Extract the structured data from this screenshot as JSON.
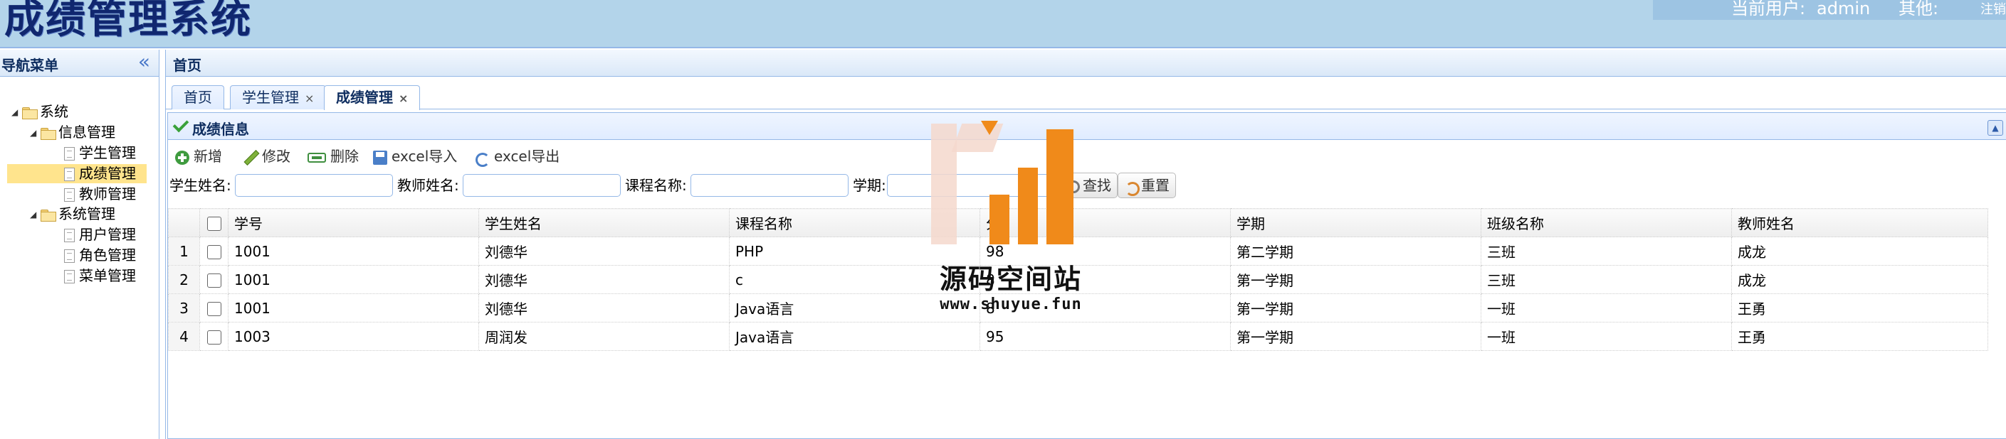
{
  "app_title": "成绩管理系统",
  "userbar": {
    "current_user_label": "当前用户:",
    "current_user": "admin",
    "other_label": "其他:",
    "logout": "注销"
  },
  "nav": {
    "title": "导航菜单",
    "collapse_icon": "double-chevron-left-icon",
    "tree": [
      {
        "label": "系统",
        "type": "folder",
        "level": 0
      },
      {
        "label": "信息管理",
        "type": "folder",
        "level": 1
      },
      {
        "label": "学生管理",
        "type": "file",
        "level": 2
      },
      {
        "label": "成绩管理",
        "type": "file",
        "level": 2,
        "selected": true
      },
      {
        "label": "教师管理",
        "type": "file",
        "level": 2
      },
      {
        "label": "系统管理",
        "type": "folder",
        "level": 1
      },
      {
        "label": "用户管理",
        "type": "file",
        "level": 2
      },
      {
        "label": "角色管理",
        "type": "file",
        "level": 2
      },
      {
        "label": "菜单管理",
        "type": "file",
        "level": 2
      }
    ]
  },
  "main": {
    "title": "首页",
    "tabs": [
      {
        "label": "首页",
        "closable": false
      },
      {
        "label": "学生管理",
        "closable": true
      },
      {
        "label": "成绩管理",
        "closable": true,
        "active": true
      }
    ],
    "tab_close": "×"
  },
  "panel": {
    "title": "成绩信息",
    "toolbar": {
      "add": "新增",
      "edit": "修改",
      "delete": "删除",
      "import": "excel导入",
      "export": "excel导出"
    },
    "search": {
      "student_label": "学生姓名:",
      "teacher_label": "教师姓名:",
      "course_label": "课程名称:",
      "term_label": "学期:",
      "search_btn": "查找",
      "reset_btn": "重置"
    },
    "grid": {
      "columns": [
        "学号",
        "学生姓名",
        "课程名称",
        "分",
        "学期",
        "班级名称",
        "教师姓名"
      ],
      "rows": [
        [
          "1001",
          "刘德华",
          "PHP",
          "98",
          "第二学期",
          "三班",
          "成龙"
        ],
        [
          "1001",
          "刘德华",
          "c",
          "8",
          "第一学期",
          "三班",
          "成龙"
        ],
        [
          "1001",
          "刘德华",
          "Java语言",
          "8",
          "第一学期",
          "一班",
          "王勇"
        ],
        [
          "1003",
          "周润发",
          "Java语言",
          "95",
          "第一学期",
          "一班",
          "王勇"
        ]
      ]
    }
  },
  "watermark": {
    "title": "源码空间站",
    "url": "www.shuyue.fun"
  },
  "colors": {
    "header_bg": "#b3d4ea",
    "title_color": "#10276f",
    "border": "#95b8e7",
    "selected": "#ffe48d",
    "watermark_orange": "#f08a1a"
  }
}
